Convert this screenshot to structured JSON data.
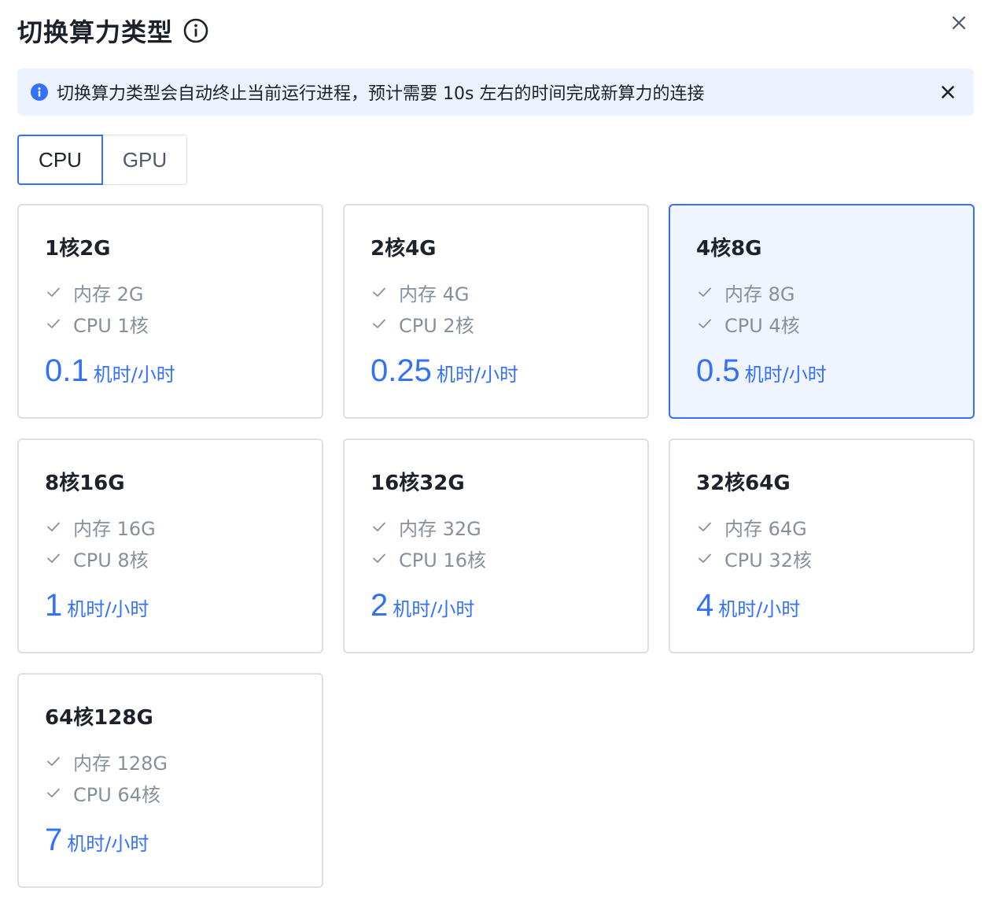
{
  "dialog": {
    "title": "切换算力类型"
  },
  "alert": {
    "message": "切换算力类型会自动终止当前运行进程，预计需要 10s 左右的时间完成新算力的连接"
  },
  "tabs": [
    {
      "label": "CPU",
      "active": true
    },
    {
      "label": "GPU",
      "active": false
    }
  ],
  "cards": [
    {
      "title": "1核2G",
      "memory": "内存 2G",
      "cpu": "CPU 1核",
      "price": "0.1",
      "unit": "机时/小时",
      "selected": false
    },
    {
      "title": "2核4G",
      "memory": "内存 4G",
      "cpu": "CPU 2核",
      "price": "0.25",
      "unit": "机时/小时",
      "selected": false
    },
    {
      "title": "4核8G",
      "memory": "内存 8G",
      "cpu": "CPU 4核",
      "price": "0.5",
      "unit": "机时/小时",
      "selected": true
    },
    {
      "title": "8核16G",
      "memory": "内存 16G",
      "cpu": "CPU 8核",
      "price": "1",
      "unit": "机时/小时",
      "selected": false
    },
    {
      "title": "16核32G",
      "memory": "内存 32G",
      "cpu": "CPU 16核",
      "price": "2",
      "unit": "机时/小时",
      "selected": false
    },
    {
      "title": "32核64G",
      "memory": "内存 64G",
      "cpu": "CPU 32核",
      "price": "4",
      "unit": "机时/小时",
      "selected": false
    },
    {
      "title": "64核128G",
      "memory": "内存 128G",
      "cpu": "CPU 64核",
      "price": "7",
      "unit": "机时/小时",
      "selected": false
    }
  ],
  "icons": {
    "title_info": "info-circle-icon",
    "dialog_close": "close-icon",
    "alert_info": "info-filled-icon",
    "alert_close": "close-icon",
    "feature": "check-icon"
  },
  "colors": {
    "primary": "#3370ff",
    "alert_bg": "#ecf2fe",
    "selected_bg": "#f0f4ff",
    "border": "#dcdfe6",
    "muted_text": "#86909c"
  }
}
